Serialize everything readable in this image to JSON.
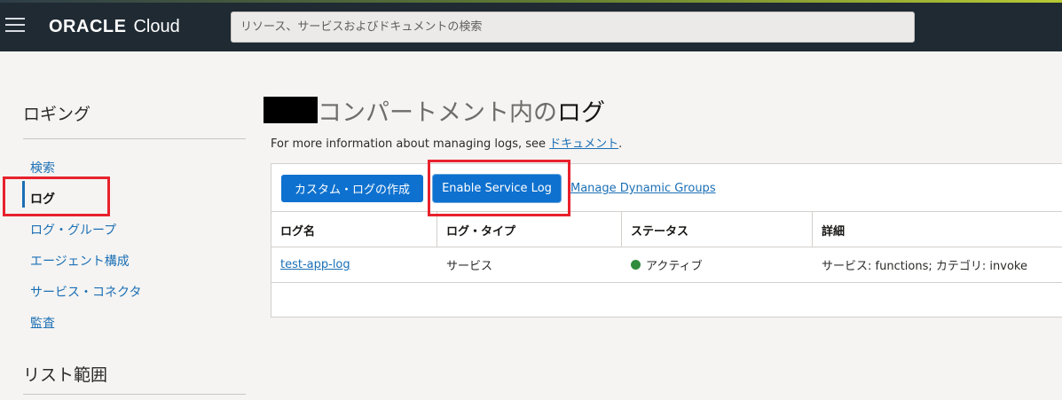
{
  "header": {
    "brand": "ORACLE",
    "product": "Cloud",
    "search_placeholder": "リソース、サービスおよびドキュメントの検索"
  },
  "sidebar": {
    "heading": "ロギング",
    "items": [
      {
        "label": "検索",
        "active": false
      },
      {
        "label": "ログ",
        "active": true
      },
      {
        "label": "ログ・グループ",
        "active": false
      },
      {
        "label": "エージェント構成",
        "active": false
      },
      {
        "label": "サービス・コネクタ",
        "active": false
      },
      {
        "label": "監査",
        "active": false
      }
    ],
    "scope_heading": "リスト範囲"
  },
  "main": {
    "title_part1": "コンパートメント内の",
    "title_part2": "ログ",
    "info_text": "For more information about managing logs, see ",
    "info_link": "ドキュメント",
    "info_suffix": ".",
    "buttons": {
      "create": "カスタム・ログの作成",
      "enable": "Enable Service Log",
      "manage": "Manage Dynamic Groups"
    },
    "table": {
      "columns": [
        "ログ名",
        "ログ・タイプ",
        "ステータス",
        "詳細"
      ],
      "rows": [
        {
          "name": "test-app-log",
          "type": "サービス",
          "status": "アクティブ",
          "details": "サービス: functions; カテゴリ: invoke"
        }
      ]
    }
  },
  "colors": {
    "accent": "#0e71cf",
    "link": "#1b6fb5",
    "status_active": "#2f8c3d",
    "highlight": "#e8212d",
    "topbar": "#1f2a33"
  }
}
